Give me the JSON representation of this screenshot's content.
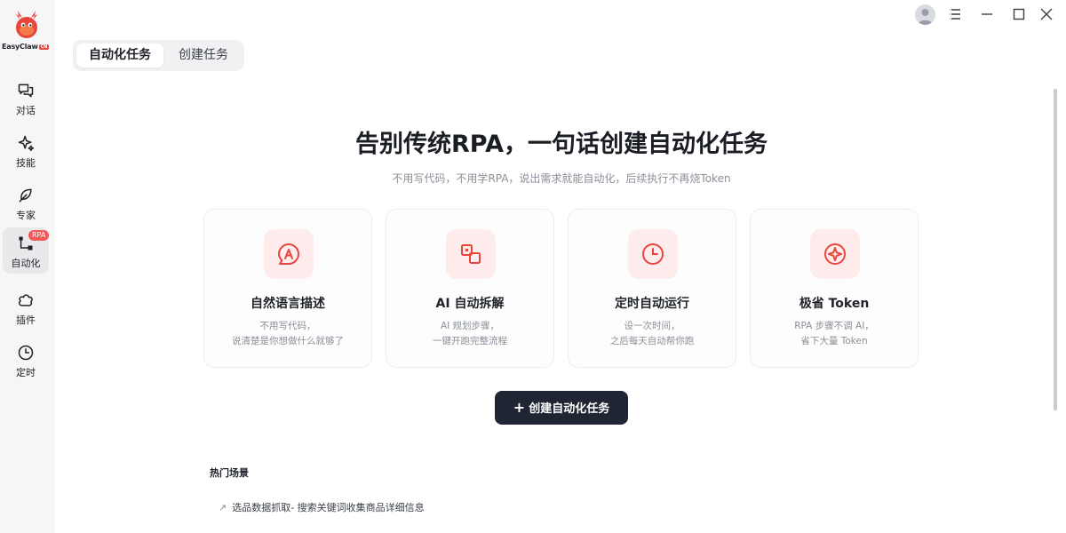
{
  "app": {
    "logo_text": "EasyClaw",
    "logo_badge": "CN"
  },
  "sidebar": {
    "items": [
      {
        "label": "对话",
        "icon": "chat-icon"
      },
      {
        "label": "技能",
        "icon": "sparkle-icon"
      },
      {
        "label": "专家",
        "icon": "leaf-icon"
      },
      {
        "label": "自动化",
        "icon": "flow-icon",
        "badge": "RPA",
        "active": true
      },
      {
        "label": "插件",
        "icon": "puzzle-icon"
      },
      {
        "label": "定时",
        "icon": "clock-icon"
      }
    ]
  },
  "tabs": [
    {
      "label": "自动化任务",
      "active": true
    },
    {
      "label": "创建任务",
      "active": false
    }
  ],
  "hero": {
    "title": "告别传统RPA，一句话创建自动化任务",
    "subtitle": "不用写代码，不用学RPA，说出需求就能自动化，后续执行不再烧Token"
  },
  "features": [
    {
      "icon": "at-bubble-icon",
      "title": "自然语言描述",
      "desc1": "不用写代码，",
      "desc2": "说清楚是你想做什么就够了"
    },
    {
      "icon": "split-squares-icon",
      "title": "AI 自动拆解",
      "desc1": "AI 规划步骤，",
      "desc2": "一键开跑完整流程"
    },
    {
      "icon": "clock-icon",
      "title": "定时自动运行",
      "desc1": "设一次时间，",
      "desc2": "之后每天自动帮你跑"
    },
    {
      "icon": "sparkle-circle-icon",
      "title": "极省 Token",
      "desc1": "RPA 步骤不调 AI，",
      "desc2": "省下大量 Token"
    }
  ],
  "cta": {
    "plus": "+",
    "label": "创建自动化任务"
  },
  "hot": {
    "title": "热门场景",
    "items": [
      {
        "arrow": "↗",
        "label": "选品数据抓取- 搜索关键词收集商品详细信息"
      }
    ]
  },
  "colors": {
    "accent": "#e8453c",
    "icon_bg": "#fdeceb",
    "cta_bg": "#1f2532"
  }
}
